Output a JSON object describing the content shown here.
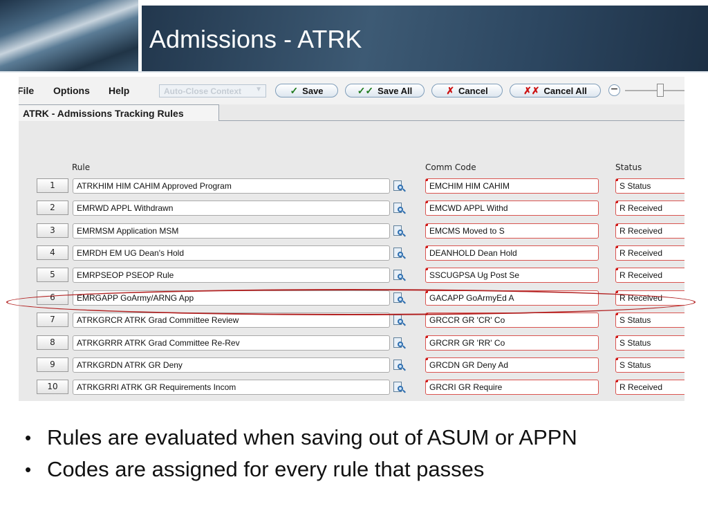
{
  "slide": {
    "title": "Admissions - ATRK",
    "bullets": [
      "Rules are evaluated when saving out of ASUM or APPN",
      "Codes are assigned for every rule that passes"
    ]
  },
  "menu": {
    "file": "File",
    "options": "Options",
    "help": "Help"
  },
  "toolbar": {
    "context_select": "Auto-Close Context",
    "save": "Save",
    "save_all": "Save All",
    "cancel": "Cancel",
    "cancel_all": "Cancel All"
  },
  "tab": {
    "label": "ATRK - Admissions Tracking Rules"
  },
  "columns": {
    "rule": "Rule",
    "comm_code": "Comm Code",
    "status": "Status"
  },
  "rows": [
    {
      "num": "1",
      "rule": "ATRKHIM  HIM CAHIM Approved Program",
      "comm": "EMCHIM   HIM CAHIM",
      "status": "S Status"
    },
    {
      "num": "2",
      "rule": "EMRWD    APPL Withdrawn",
      "comm": "EMCWD    APPL Withd",
      "status": "R Received"
    },
    {
      "num": "3",
      "rule": "EMRMSM   Application MSM",
      "comm": "EMCMS    Moved to S",
      "status": "R Received"
    },
    {
      "num": "4",
      "rule": "EMRDH    EM UG Dean's Hold",
      "comm": "DEANHOLD Dean Hold",
      "status": "R Received"
    },
    {
      "num": "5",
      "rule": "EMRPSEOP PSEOP Rule",
      "comm": "SSCUGPSA Ug Post Se",
      "status": "R Received"
    },
    {
      "num": "6",
      "rule": "EMRGAPP  GoArmy/ARNG App",
      "comm": "GACAPP   GoArmyEd A",
      "status": "R Received"
    },
    {
      "num": "7",
      "rule": "ATRKGRCR ATRK Grad Committee Review",
      "comm": "GRCCR    GR 'CR' Co",
      "status": "S Status"
    },
    {
      "num": "8",
      "rule": "ATRKGRRR ATRK Grad Committee Re-Rev",
      "comm": "GRCRR    GR 'RR' Co",
      "status": "S Status"
    },
    {
      "num": "9",
      "rule": "ATRKGRDN ATRK GR Deny",
      "comm": "GRCDN    GR Deny Ad",
      "status": "S Status"
    },
    {
      "num": "10",
      "rule": "ATRKGRRI ATRK GR Requirements Incom",
      "comm": "GRCRI    GR Require",
      "status": "R Received"
    }
  ]
}
